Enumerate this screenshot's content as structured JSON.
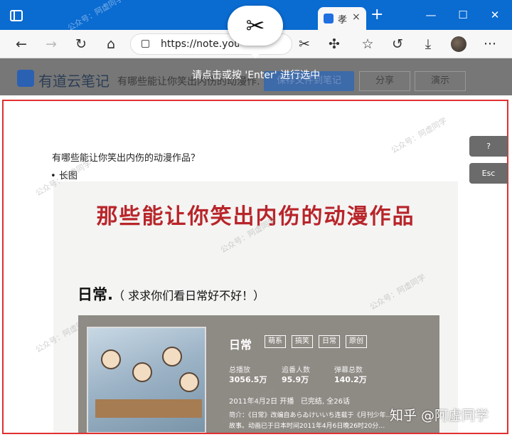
{
  "browser": {
    "active_tab_title": "孝",
    "tab_close": "×",
    "new_tab": "+",
    "window_controls": {
      "minimize": "—",
      "maximize": "☐",
      "close": "✕"
    },
    "url": "https://note.youdao...",
    "icons": {
      "back": "←",
      "forward": "→",
      "reload": "↻",
      "home": "⌂",
      "screenshot": "✂",
      "extensions": "✣",
      "favorites": "☆",
      "history": "↺",
      "downloads": "⤓",
      "menu": "···"
    },
    "scissor_icon": "✂"
  },
  "youdao": {
    "brand": "有道云笔记",
    "doc_title": "有哪些能让你笑出内伤的动漫作…",
    "save_button": "保存文件到笔记",
    "share_button": "分享",
    "demo_button": "演示"
  },
  "overlay_hint": "请点击或按 'Enter' 进行选中",
  "document": {
    "question": "有哪些能让你笑出内伤的动漫作品？",
    "bullet": "长图",
    "image": {
      "title": "那些能让你笑出内伤的动漫作品",
      "subtitle_main": "日常.",
      "subtitle_note": "（ 求求你们看日常好不好！）",
      "anime_name": "日常",
      "tags": [
        "萌系",
        "搞笑",
        "日常",
        "原创"
      ],
      "stats": [
        {
          "label": "总播放",
          "value": "3056.5万"
        },
        {
          "label": "追番人数",
          "value": "95.9万"
        },
        {
          "label": "弹幕总数",
          "value": "140.2万"
        }
      ],
      "air_date": "2011年4月2日 开播",
      "status": "已完结, 全26话",
      "intro_1": "简介：《日常》改编自あらゐけいいち连载于《月刊少年……",
      "intro_2": "故事。动画已于日本时间2011年4月6日晚26时20分…"
    }
  },
  "side_buttons": {
    "help": "?",
    "esc": "Esc"
  },
  "watermark": {
    "zhihu": "知乎 @阿虚同学",
    "wechat": "公众号：阿虚同学"
  }
}
